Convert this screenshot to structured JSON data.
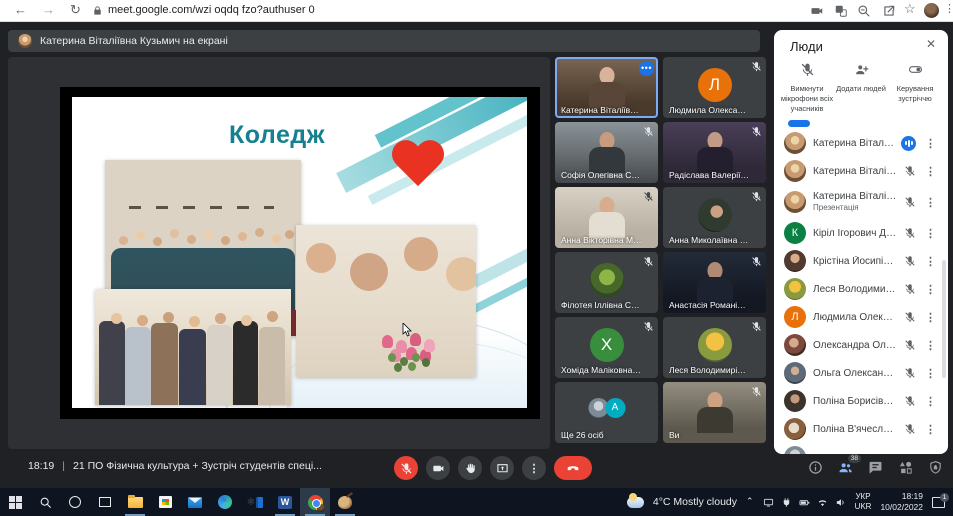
{
  "browser": {
    "url": "meet.google.com/wzi oqdq fzo?authuser 0"
  },
  "banner": {
    "text": "Катерина Віталіївна Кузьмич на екрані"
  },
  "slide": {
    "title": "Коледж",
    "accent_color": "#16808f",
    "heart_color": "#ea3223"
  },
  "tiles": [
    {
      "name": "Катерина Віталіївна К...",
      "type": "video",
      "active": true,
      "menu": "•••"
    },
    {
      "name": "Людмила Олександрів...",
      "type": "letter",
      "letter": "Л",
      "color": "#e8710a"
    },
    {
      "name": "Софія Олегівна Скрип...",
      "type": "video"
    },
    {
      "name": "Радіслава Валеріївна ...",
      "type": "video"
    },
    {
      "name": "Анна Вікторівна Масл...",
      "type": "video"
    },
    {
      "name": "Анна Миколаївна Берд...",
      "type": "photo"
    },
    {
      "name": "Філотея Іллівна Сурду",
      "type": "photo"
    },
    {
      "name": "Анастасія Романівна Б...",
      "type": "video"
    },
    {
      "name": "Хоміда Маліковна Суфі...",
      "type": "letter",
      "letter": "X",
      "color": "#388e3c"
    },
    {
      "name": "Леся Володимирівна Ш...",
      "type": "photo"
    },
    {
      "name": "Ще 26 осіб",
      "type": "overflow",
      "letter": "А",
      "color": "#00acc1"
    },
    {
      "name": "Ви",
      "type": "video"
    }
  ],
  "controls": {
    "time": "18:19",
    "separator": "|",
    "meeting_name": "21 ПО Фізична культура + Зустріч студентів спеці...",
    "people_count": "38"
  },
  "people_panel": {
    "title": "Люди",
    "close": "✕",
    "actions": [
      {
        "label": "Вимкнути мікрофони всіх учасників"
      },
      {
        "label": "Додати людей"
      },
      {
        "label": "Керування зустріччю"
      }
    ],
    "participants": [
      {
        "name": "Катерина Віталіївна Кузь...",
        "status": "speaking"
      },
      {
        "name": "Катерина Віталіївна Кузь...",
        "status": "muted"
      },
      {
        "name": "Катерина Віталіївна Кузь...",
        "subtitle": "Презентація",
        "status": "muted"
      },
      {
        "name": "Кіріл Ігорович Добрянсь...",
        "letter": "К",
        "color": "#0b8043",
        "status": "muted"
      },
      {
        "name": "Крістіна Йосипівна Тороні",
        "status": "muted"
      },
      {
        "name": "Леся Володимирівна Ше...",
        "status": "muted"
      },
      {
        "name": "Людмила Олександрівн...",
        "letter": "Л",
        "color": "#e8710a",
        "status": "muted"
      },
      {
        "name": "Олександра Олександр...",
        "status": "muted"
      },
      {
        "name": "Ольга Олександрівна Д...",
        "status": "muted"
      },
      {
        "name": "Поліна Борисівна Бадах",
        "status": "muted"
      },
      {
        "name": "Поліна В'ячеславівна Да...",
        "status": "muted"
      }
    ]
  },
  "taskbar": {
    "weather": "4°C Mostly cloudy",
    "language_line1": "УКР",
    "language_line2": "UKR",
    "time": "18:19",
    "date": "10/02/2022",
    "notification_count": "1"
  }
}
